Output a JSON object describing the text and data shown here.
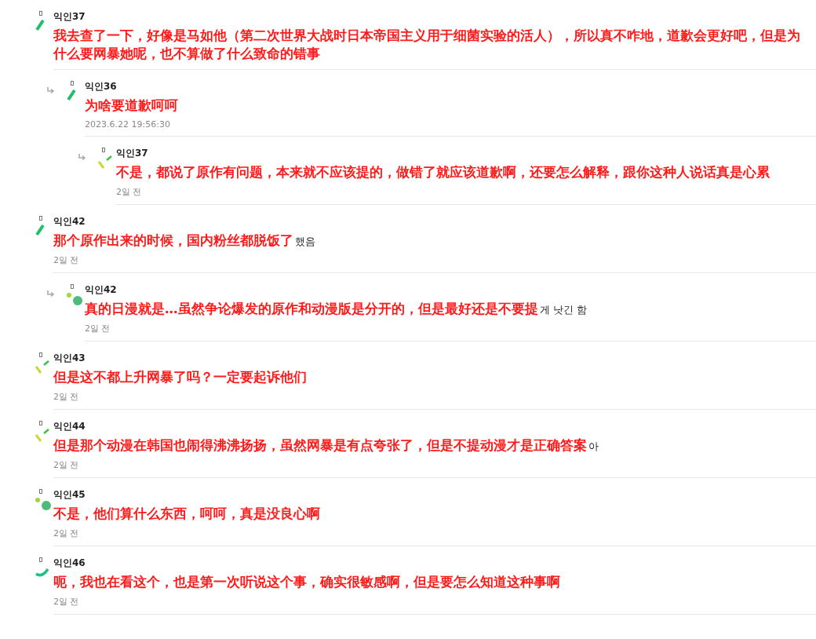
{
  "comments": [
    {
      "author": "익인37",
      "kind": "dash",
      "text": "我去查了一下，好像是马如他（第二次世界大战时日本帝国主义用于细菌实验的活人），所以真不咋地，道歉会更好吧，但是为什么要网暴她呢，也不算做了什么致命的错事",
      "children": [
        {
          "author": "익인36",
          "kind": "dash",
          "text": "为啥要道歉呵呵",
          "time": "2023.6.22 19:56:30",
          "children": [
            {
              "author": "익인37",
              "kind": "check",
              "text": "不是，都说了原作有问题，本来就不应该提的，做错了就应该道歉啊，还要怎么解释，跟你这种人说话真是心累",
              "time": "2일 전"
            }
          ]
        }
      ]
    },
    {
      "author": "익인42",
      "kind": "dash",
      "text": "那个原作出来的时候，国内粉丝都脱饭了",
      "tail": "했음",
      "time": "2일 전",
      "children": [
        {
          "author": "익인42",
          "kind": "dots",
          "text": "真的日漫就是…虽然争论爆发的原作和动漫版是分开的，但是最好还是不要提",
          "tail": "게 낫긴 함",
          "time": "2일 전"
        }
      ]
    },
    {
      "author": "익인43",
      "kind": "check",
      "text": "但是这不都上升网暴了吗？一定要起诉他们",
      "time": "2일 전"
    },
    {
      "author": "익인44",
      "kind": "check",
      "text": "但是那个动漫在韩国也闹得沸沸扬扬，虽然网暴是有点夸张了，但是不提动漫才是正确答案",
      "tail": "아",
      "time": "2일 전"
    },
    {
      "author": "익인45",
      "kind": "dots",
      "text": "不是，他们算什么东西，呵呵，真是没良心啊",
      "time": "2일 전"
    },
    {
      "author": "익인46",
      "kind": "arc",
      "text": "呃，我也在看这个，也是第一次听说这个事，确实很敏感啊，但是要怎么知道这种事啊",
      "time": "2일 전"
    }
  ]
}
